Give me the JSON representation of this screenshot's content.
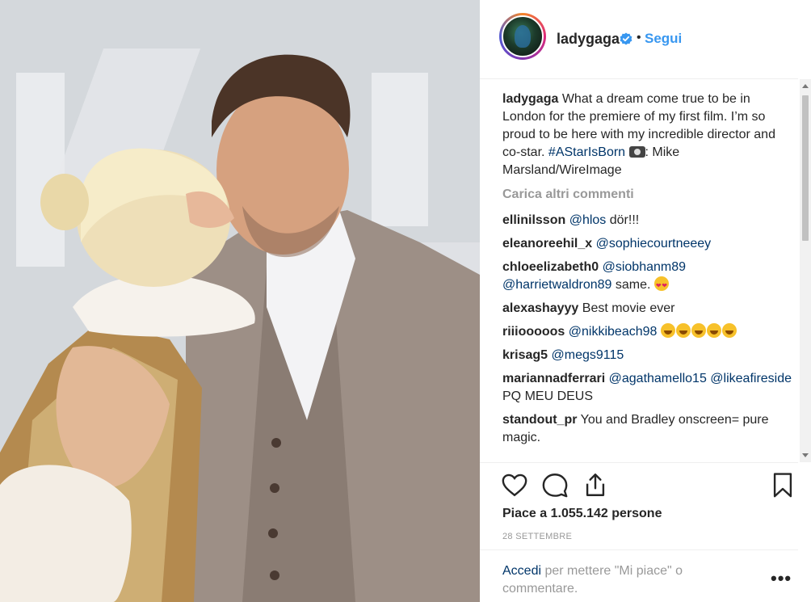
{
  "post": {
    "photo_alt": "Photo",
    "author": "ladygaga",
    "follow_label": "Segui",
    "verified_icon": "verified-badge-icon",
    "caption": {
      "username": "ladygaga",
      "text_1": "What a dream come true to be in London for the premiere of my first film. I’m so proud to be here with my incredible director and co-star.",
      "hashtag": "#AStarIsBorn",
      "text_2": ": Mike Marsland/WireImage"
    },
    "load_more_label": "Carica altri commenti",
    "comments": [
      {
        "user": "ellinilsson",
        "mention": "@hlos",
        "text": "dör!!!"
      },
      {
        "user": "eleanoreehil_x",
        "mention": "@sophiecourtneeey",
        "text": ""
      },
      {
        "user": "chloeelizabeth0",
        "mention": "@siobhanm89",
        "mention2": "@harrietwaldron89",
        "text": "same."
      },
      {
        "user": "alexashayyy",
        "text": "Best movie ever"
      },
      {
        "user": "riiiooooos",
        "mention": "@nikkibeach98",
        "text": ""
      },
      {
        "user": "krisag5",
        "mention": "@megs9115",
        "text": ""
      },
      {
        "user": "mariannadferrari",
        "mention": "@agathamello15",
        "mention2": "@likeafireside",
        "text": "PQ MEU DEUS"
      },
      {
        "user": "standout_pr",
        "text": "You and Bradley onscreen= pure magic."
      }
    ],
    "likes_label": "Piace a 1.055.142 persone",
    "date": "28 SETTEMBRE",
    "login_link": "Accedi",
    "login_text": "per mettere \"Mi piace\" o commentare.",
    "icons": {
      "like": "heart-icon",
      "comment": "comment-icon",
      "share": "share-icon",
      "save": "bookmark-icon",
      "options": "more-options-icon"
    }
  }
}
